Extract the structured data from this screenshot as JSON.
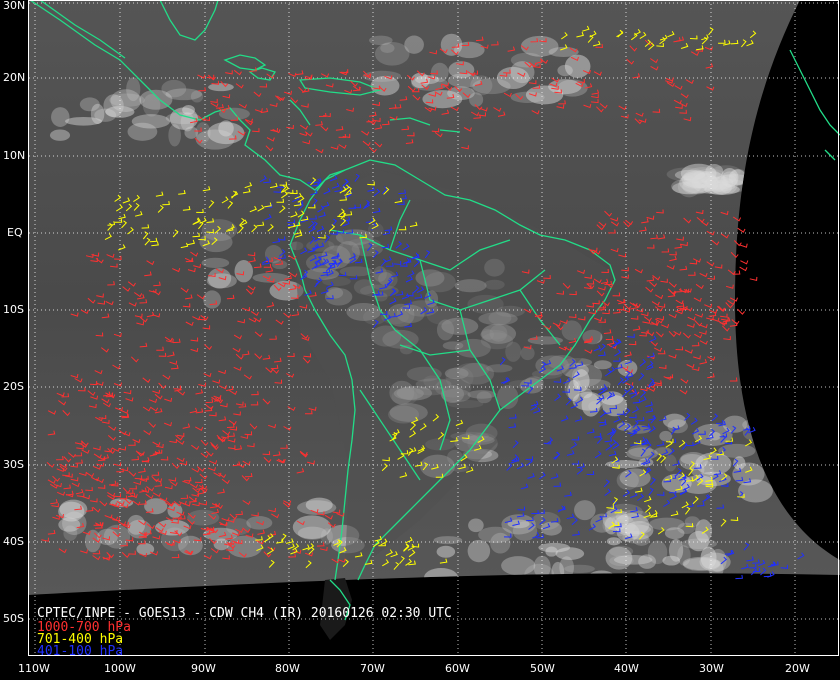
{
  "caption": {
    "title": "CPTEC/INPE - GOES13 - CDW CH4 (IR) 20160126 02:30 UTC",
    "legend": [
      {
        "label": "1000-700 hPa",
        "color": "#ff3030"
      },
      {
        "label": "701-400 hPa",
        "color": "#ffff00"
      },
      {
        "label": "401-100 hPa",
        "color": "#2030ff"
      }
    ]
  },
  "lat_labels": [
    "30N",
    "20N",
    "10N",
    "EQ",
    "10S",
    "20S",
    "30S",
    "40S",
    "50S"
  ],
  "lon_labels": [
    "110W",
    "100W",
    "90W",
    "80W",
    "70W",
    "60W",
    "50W",
    "40W",
    "30W",
    "20W"
  ],
  "colors": {
    "coastline": "#22dd88",
    "grid": "#ffffff",
    "background": "#000000",
    "frame": "#ffffff"
  }
}
